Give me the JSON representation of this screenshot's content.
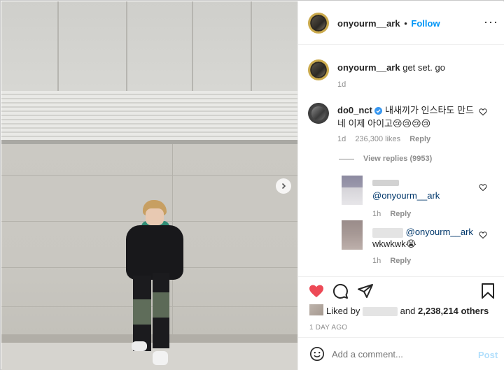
{
  "header": {
    "username": "onyourm__ark",
    "separator": "•",
    "follow_label": "Follow",
    "more_label": "···"
  },
  "caption": {
    "username": "onyourm__ark",
    "text": "get set. go",
    "time": "1d"
  },
  "comment": {
    "username": "do0_nct",
    "text": "내새끼가 인스타도 만드네 이제 아이고😢😢😢😢",
    "time": "1d",
    "likes": "236,300 likes",
    "reply_label": "Reply",
    "view_replies": "View replies (9953)"
  },
  "replies": [
    {
      "mention": "@onyourm__ark",
      "time": "1h",
      "reply_label": "Reply"
    },
    {
      "mention": "@onyourm__ark",
      "text": "wkwkwk😭",
      "time": "1h",
      "reply_label": "Reply"
    }
  ],
  "likes": {
    "prefix": "Liked by",
    "middle": "and",
    "count": "2,238,214 others"
  },
  "post_time": "1 DAY AGO",
  "add_comment": {
    "placeholder": "Add a comment...",
    "post_label": "Post"
  },
  "icons": [
    "next-arrow-icon",
    "more-icon",
    "heart-icon",
    "comment-icon",
    "share-icon",
    "bookmark-icon",
    "emoji-icon",
    "verified-icon"
  ],
  "colors": {
    "accent": "#0095f6",
    "like": "#ed4956",
    "muted": "#8e8e8e",
    "verified": "#3897f0"
  }
}
